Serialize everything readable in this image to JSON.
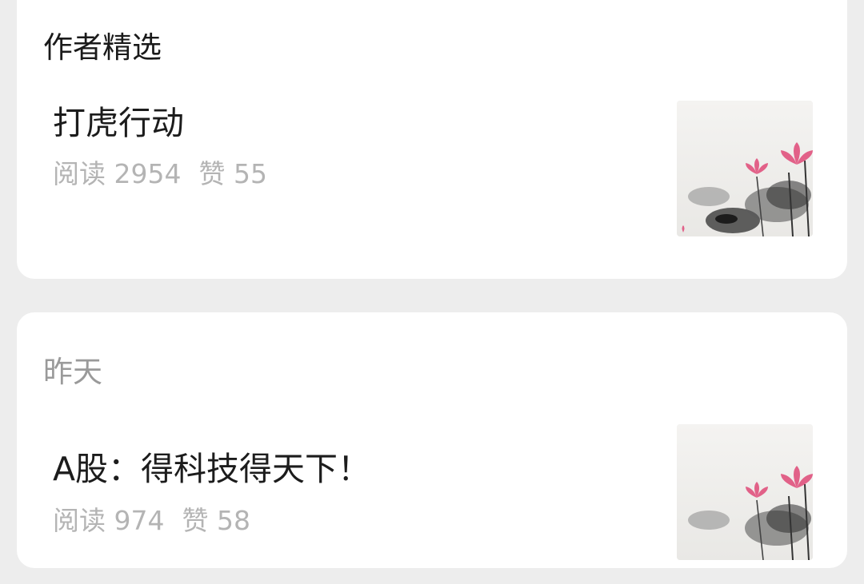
{
  "featured": {
    "section_title": "作者精选",
    "article": {
      "title": "打虎行动",
      "reads_label": "阅读",
      "reads_count": "2954",
      "likes_label": "赞",
      "likes_count": "55",
      "thumbnail_icon": "lotus-ink-painting"
    }
  },
  "recent": {
    "section_title": "昨天",
    "article": {
      "title": "A股：得科技得天下！",
      "reads_label": "阅读",
      "reads_count": "974",
      "likes_label": "赞",
      "likes_count": "58",
      "thumbnail_icon": "lotus-ink-painting"
    }
  },
  "colors": {
    "background": "#ededed",
    "card": "#ffffff",
    "title_text": "#1c1c1c",
    "meta_text": "#b4b4b4",
    "lotus_pink": "#e0527e"
  }
}
